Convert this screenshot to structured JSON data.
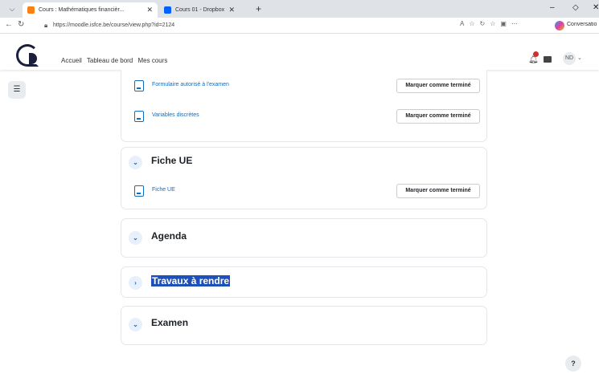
{
  "browser": {
    "tabs": [
      {
        "label": "Cours : Mathématiques financièr..."
      },
      {
        "label": "Cours 01 - Dropbox"
      }
    ],
    "url": "https://moodle.isfce.be/course/view.php?id=2124",
    "copilot_label": "Conversatio"
  },
  "navbar": {
    "links": [
      "Accueil",
      "Tableau de bord",
      "Mes cours"
    ],
    "user_initials": "ND"
  },
  "sections": {
    "top": {
      "activities": [
        {
          "label": "Formulaire autorisé à l'examen",
          "button": "Marquer comme terminé"
        },
        {
          "label": "Variables discrètes",
          "button": "Marquer comme terminé"
        }
      ]
    },
    "fiche": {
      "title": "Fiche UE",
      "activities": [
        {
          "label": "Fiche UE",
          "button": "Marquer comme terminé"
        }
      ]
    },
    "agenda": {
      "title": "Agenda"
    },
    "travaux": {
      "title": "Travaux à rendre"
    },
    "examen": {
      "title": "Examen"
    }
  },
  "help": {
    "label": "?"
  },
  "colors": {
    "accent": "#0f6cbf",
    "selection": "#1e51b8",
    "badge": "#d32f2f"
  }
}
